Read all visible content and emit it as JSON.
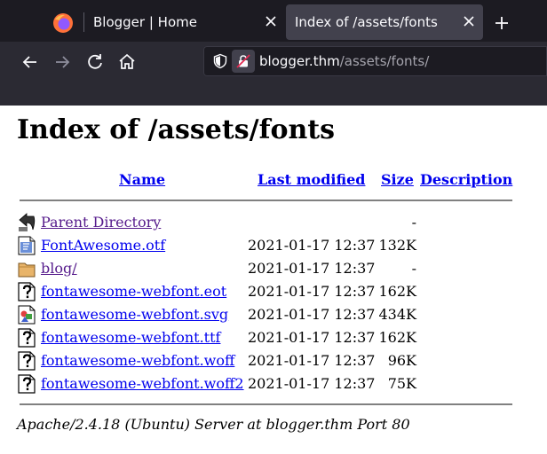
{
  "browser": {
    "tabs": [
      {
        "label": "Blogger | Home"
      },
      {
        "label": "Index of /assets/fonts"
      }
    ],
    "url": {
      "host": "blogger.thm",
      "path": "/assets/fonts/"
    },
    "icons": [
      "firefox-logo-icon",
      "close-icon",
      "plus-icon",
      "back-icon",
      "forward-icon",
      "reload-icon",
      "home-icon",
      "shield-icon",
      "lock-icon"
    ]
  },
  "page": {
    "title": "Index of /assets/fonts",
    "columns": {
      "name": "Name",
      "last_modified": "Last modified",
      "size": "Size",
      "description": "Description"
    },
    "entries": [
      {
        "name": "Parent Directory",
        "modified": "",
        "size": "-",
        "icon": "back-arrow-icon",
        "visited": true
      },
      {
        "name": "FontAwesome.otf",
        "modified": "2021-01-17 12:37",
        "size": "132K",
        "icon": "font-file-icon",
        "visited": false
      },
      {
        "name": "blog/",
        "modified": "2021-01-17 12:37",
        "size": "-",
        "icon": "folder-icon",
        "visited": true
      },
      {
        "name": "fontawesome-webfont.eot",
        "modified": "2021-01-17 12:37",
        "size": "162K",
        "icon": "unknown-file-icon",
        "visited": false
      },
      {
        "name": "fontawesome-webfont.svg",
        "modified": "2021-01-17 12:37",
        "size": "434K",
        "icon": "image-file-icon",
        "visited": false
      },
      {
        "name": "fontawesome-webfont.ttf",
        "modified": "2021-01-17 12:37",
        "size": "162K",
        "icon": "unknown-file-icon",
        "visited": false
      },
      {
        "name": "fontawesome-webfont.woff",
        "modified": "2021-01-17 12:37",
        "size": "96K",
        "icon": "unknown-file-icon",
        "visited": false
      },
      {
        "name": "fontawesome-webfont.woff2",
        "modified": "2021-01-17 12:37",
        "size": "75K",
        "icon": "unknown-file-icon",
        "visited": false
      }
    ],
    "footer": "Apache/2.4.18 (Ubuntu) Server at blogger.thm Port 80"
  }
}
